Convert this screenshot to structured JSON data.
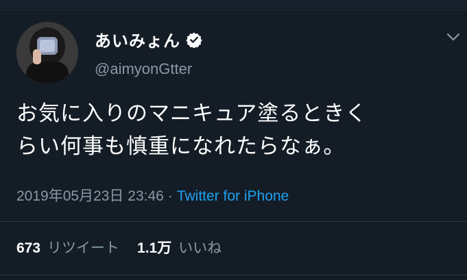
{
  "tweet": {
    "display_name": "あいみょん",
    "handle": "@aimyonGtter",
    "text_line1": "お気に入りのマニキュア塗るときく",
    "text_line2": "らい何事も慎重になれたらなぁ。",
    "timestamp": "2019年05月23日 23:46",
    "separator": "·",
    "source": "Twitter for iPhone",
    "retweet_count": "673",
    "retweet_label": "リツイート",
    "like_count": "1.1万",
    "like_label": "いいね"
  },
  "colors": {
    "background": "#141d26",
    "secondary_text": "#8899a6",
    "link": "#1da1f2"
  },
  "icons": {
    "verified": "verified-badge-icon",
    "menu": "chevron-down-icon"
  }
}
